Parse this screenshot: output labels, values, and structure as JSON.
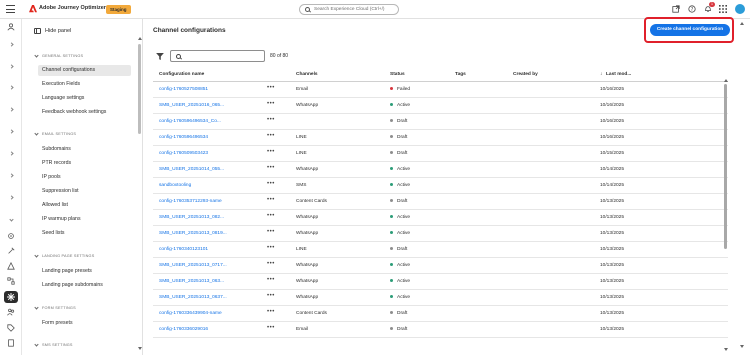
{
  "app": {
    "name": "Adobe Journey Optimizer",
    "env_badge": "Staging",
    "search_placeholder": "Search Experience Cloud (Ctrl+/)",
    "notification_count": "1",
    "brand_color": "#e1251b",
    "accent_color": "#1473e6"
  },
  "rail": {
    "icons": [
      "person-icon",
      "chevron-icon",
      "chevron-icon",
      "chevron-icon",
      "chevron-icon",
      "chevron-icon",
      "chevron-icon",
      "chevron-icon",
      "chevron-icon",
      "chevron-icon",
      "chevron-icon",
      "settings-icon",
      "gear-cog-icon",
      "alert-icon",
      "flow-icon",
      "channels-icon",
      "people-icon",
      "tag-icon",
      "document-icon"
    ]
  },
  "panel": {
    "hide_label": "Hide panel",
    "sections": [
      {
        "title": "GENERAL SETTINGS",
        "items": [
          "Channel configurations",
          "Execution Fields",
          "Language settings",
          "Feedback webhook settings"
        ]
      },
      {
        "title": "EMAIL SETTINGS",
        "items": [
          "Subdomains",
          "PTR records",
          "IP pools",
          "Suppression list",
          "Allowed list",
          "IP warmup plans",
          "Seed lists"
        ]
      },
      {
        "title": "LANDING PAGE SETTINGS",
        "items": [
          "Landing page presets",
          "Landing page subdomains"
        ]
      },
      {
        "title": "FORM SETTINGS",
        "items": [
          "Form presets"
        ]
      },
      {
        "title": "SMS SETTINGS",
        "items": []
      }
    ]
  },
  "main": {
    "title": "Channel configurations",
    "create_button": "Create channel configuration",
    "count": "80 of 80",
    "columns": {
      "name": "Configuration name",
      "channels": "Channels",
      "status": "Status",
      "tags": "Tags",
      "created_by": "Created by",
      "last_modified": "Last mod..."
    },
    "status_colors": {
      "Failed": "#d7373f",
      "Active": "#2d9d78",
      "Draft": "#8e8e8e"
    },
    "rows": [
      {
        "name": "config-1760527508851",
        "channel": "Email",
        "status": "Failed",
        "date": "10/16/2025"
      },
      {
        "name": "SMB_USER_20251016_065...",
        "channel": "WhatsApp",
        "status": "Active",
        "date": "10/16/2025"
      },
      {
        "name": "config-1760596496534_Co...",
        "channel": "",
        "status": "Draft",
        "date": "10/16/2025"
      },
      {
        "name": "config-1760596496534",
        "channel": "LINE",
        "status": "Draft",
        "date": "10/16/2025"
      },
      {
        "name": "config-1760509503423",
        "channel": "LINE",
        "status": "Draft",
        "date": "10/15/2025"
      },
      {
        "name": "SMB_USER_20251014_055...",
        "channel": "WhatsApp",
        "status": "Active",
        "date": "10/14/2025"
      },
      {
        "name": "sandboxtooling",
        "channel": "SMS",
        "status": "Active",
        "date": "10/14/2025"
      },
      {
        "name": "config-1760353712293-name",
        "channel": "Content Cards",
        "status": "Draft",
        "date": "10/13/2025"
      },
      {
        "name": "SMB_USER_20251013_082...",
        "channel": "WhatsApp",
        "status": "Active",
        "date": "10/13/2025"
      },
      {
        "name": "SMB_USER_20251013_0819...",
        "channel": "WhatsApp",
        "status": "Active",
        "date": "10/13/2025"
      },
      {
        "name": "config-1760340123101",
        "channel": "LINE",
        "status": "Draft",
        "date": "10/13/2025"
      },
      {
        "name": "SMB_USER_20251013_0717...",
        "channel": "WhatsApp",
        "status": "Active",
        "date": "10/13/2025"
      },
      {
        "name": "SMB_USER_20251013_063...",
        "channel": "WhatsApp",
        "status": "Active",
        "date": "10/13/2025"
      },
      {
        "name": "SMB_USER_20251013_0637...",
        "channel": "WhatsApp",
        "status": "Active",
        "date": "10/13/2025"
      },
      {
        "name": "config-1760336439904-name",
        "channel": "Content Cards",
        "status": "Draft",
        "date": "10/13/2025"
      },
      {
        "name": "config-1760336029016",
        "channel": "Email",
        "status": "Draft",
        "date": "10/13/2025"
      }
    ]
  }
}
